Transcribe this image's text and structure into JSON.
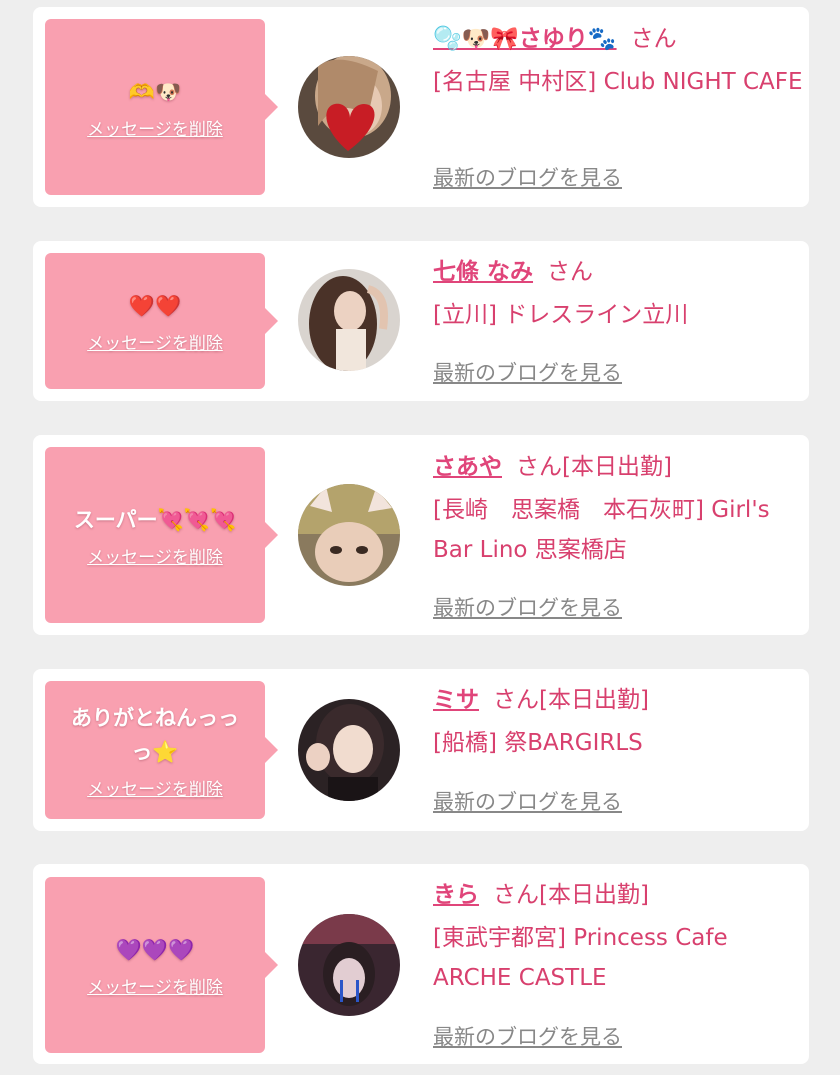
{
  "common": {
    "delete_label": "メッセージを削除",
    "blog_label": "最新のブログを見る"
  },
  "cards": [
    {
      "message": "🫶🐶",
      "name": "🫧🐶🎀さゆり🐾",
      "honorific": "さん",
      "shop": "[名古屋 中村区] Club NIGHT CAFE"
    },
    {
      "message": "❤️❤️",
      "name": "七條 なみ",
      "honorific": "さん",
      "shop": "[立川] ドレスライン立川"
    },
    {
      "message": "スーパー💘💘💘",
      "name": "さあや",
      "honorific": "さん[本日出勤]",
      "shop": "[長崎　思案橋　本石灰町] Girl's Bar Lino 思案橋店"
    },
    {
      "message": "ありがとねんっっっ⭐",
      "name": "ミサ",
      "honorific": "さん[本日出勤]",
      "shop": "[船橋] 祭BARGIRLS"
    },
    {
      "message": "💜💜💜",
      "name": "きら",
      "honorific": "さん[本日出勤]",
      "shop": "[東武宇都宮] Princess Cafe ARCHE CASTLE"
    }
  ],
  "colors": {
    "bubble": "#f9a0b0",
    "accent": "#d8406e",
    "background": "#eeeeee"
  }
}
